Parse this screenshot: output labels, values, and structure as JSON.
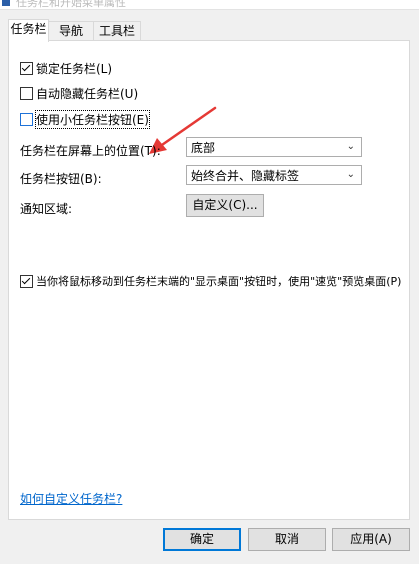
{
  "window": {
    "title": "任务栏和开始菜单属性"
  },
  "tabs": [
    {
      "label": "任务栏"
    },
    {
      "label": "导航"
    },
    {
      "label": "工具栏"
    }
  ],
  "options": {
    "lock": {
      "label": "锁定任务栏(L)",
      "checked": true
    },
    "autohide": {
      "label": "自动隐藏任务栏(U)",
      "checked": false
    },
    "small_buttons": {
      "label": "使用小任务栏按钮(E)",
      "checked": false
    }
  },
  "location": {
    "label": "任务栏在屏幕上的位置(T):",
    "value": "底部"
  },
  "buttons_combine": {
    "label": "任务栏按钮(B):",
    "value": "始终合并、隐藏标签"
  },
  "notification": {
    "label": "通知区域:",
    "button": "自定义(C)..."
  },
  "peek": {
    "label": "当你将鼠标移动到任务栏末端的\"显示桌面\"按钮时，使用\"速览\"预览桌面(P)",
    "checked": true
  },
  "help_link": "如何自定义任务栏?",
  "footer": {
    "ok": "确定",
    "cancel": "取消",
    "apply": "应用(A)"
  },
  "colors": {
    "annotation_arrow": "#e53935",
    "accent": "#0078d7",
    "link": "#0066cc"
  }
}
